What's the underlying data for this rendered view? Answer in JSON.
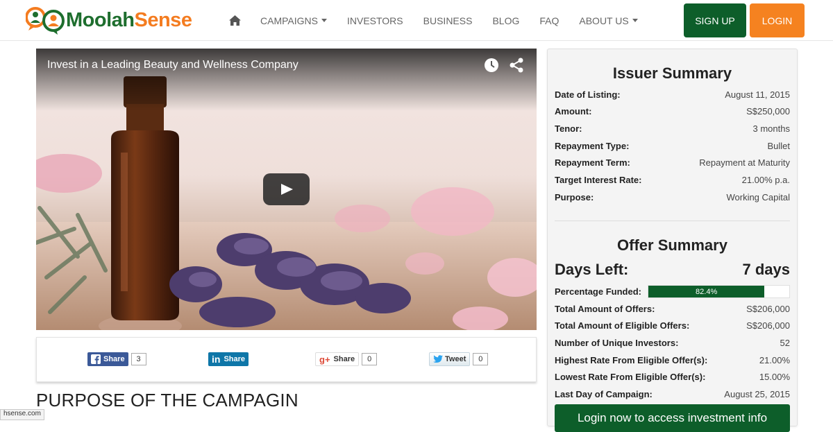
{
  "brand": {
    "name_part1": "Moolah",
    "name_part2": "Sense",
    "colors": {
      "green": "#0d5e2a",
      "orange": "#f58220"
    }
  },
  "nav": {
    "home_icon": "home-icon",
    "items": [
      "CAMPAIGNS",
      "INVESTORS",
      "BUSINESS",
      "BLOG",
      "FAQ",
      "ABOUT US"
    ],
    "signup_label": "SIGN UP",
    "login_label": "LOGIN"
  },
  "video": {
    "title": "Invest in a Leading Beauty and Wellness Company",
    "icons": [
      "clock-icon",
      "share-icon",
      "play-icon"
    ]
  },
  "share": {
    "facebook": {
      "label": "Share",
      "count": "3"
    },
    "linkedin": {
      "label": "Share"
    },
    "googleplus": {
      "label": "Share",
      "count": "0"
    },
    "twitter": {
      "label": "Tweet",
      "count": "0"
    }
  },
  "purpose_heading": "PURPOSE OF THE CAMPAGIN",
  "status_url": "hsense.com",
  "issuer": {
    "title": "Issuer Summary",
    "rows": [
      {
        "k": "Date of Listing:",
        "v": "August 11, 2015"
      },
      {
        "k": "Amount:",
        "v": "S$250,000"
      },
      {
        "k": "Tenor:",
        "v": "3 months"
      },
      {
        "k": "Repayment Type:",
        "v": "Bullet"
      },
      {
        "k": "Repayment Term:",
        "v": "Repayment at Maturity"
      },
      {
        "k": "Target Interest Rate:",
        "v": "21.00% p.a."
      },
      {
        "k": "Purpose:",
        "v": "Working Capital"
      }
    ]
  },
  "offer": {
    "title": "Offer Summary",
    "days_left_label": "Days Left:",
    "days_left_value": "7 days",
    "percentage_label": "Percentage Funded:",
    "percentage_text": "82.4%",
    "percentage_funded": 0.824,
    "rows": [
      {
        "k": "Total Amount of Offers:",
        "v": "S$206,000"
      },
      {
        "k": "Total Amount of Eligible Offers:",
        "v": "S$206,000"
      },
      {
        "k": "Number of Unique Investors:",
        "v": "52"
      },
      {
        "k": "Highest Rate From Eligible Offer(s):",
        "v": "21.00%"
      },
      {
        "k": "Lowest Rate From Eligible Offer(s):",
        "v": "15.00%"
      },
      {
        "k": "Last Day of Campaign:",
        "v": "August 25, 2015"
      }
    ],
    "cta_label": "Login now to access investment info"
  }
}
